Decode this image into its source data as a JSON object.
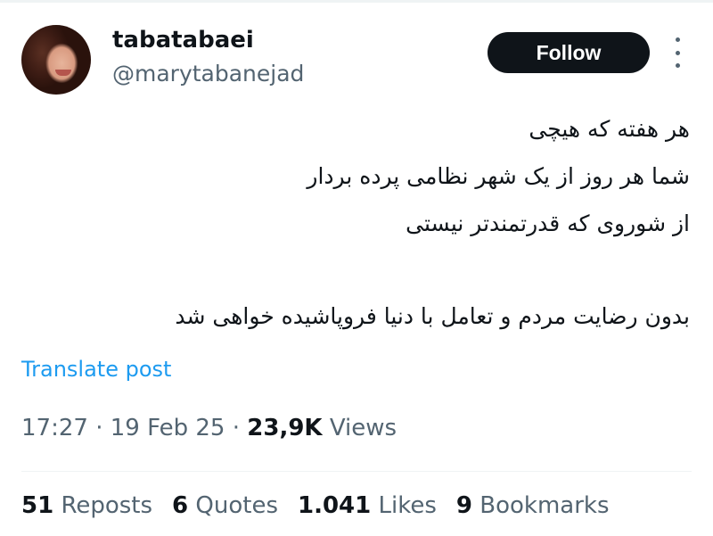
{
  "author": {
    "display_name": "tabatabaei",
    "handle": "@marytabanejad"
  },
  "actions": {
    "follow_label": "Follow",
    "more_icon": "more-vertical-icon"
  },
  "post": {
    "lines": [
      "هر هفته که هیچی",
      "شما هر روز از یک شهر نظامی پرده بردار",
      "از شوروی که قدرتمندتر نیستی",
      "بدون رضایت مردم و تعامل با دنیا فروپاشیده خواهی شد"
    ],
    "translate_label": "Translate post"
  },
  "meta": {
    "time": "17:27",
    "date": "19 Feb 25",
    "views_count": "23,9K",
    "views_label": "Views"
  },
  "stats": {
    "reposts_count": "51",
    "reposts_label": "Reposts",
    "quotes_count": "6",
    "quotes_label": "Quotes",
    "likes_count": "1.041",
    "likes_label": "Likes",
    "bookmarks_count": "9",
    "bookmarks_label": "Bookmarks"
  },
  "colors": {
    "text": "#0f1419",
    "secondary": "#536471",
    "link": "#1d9bf0",
    "button": "#0f1419"
  }
}
